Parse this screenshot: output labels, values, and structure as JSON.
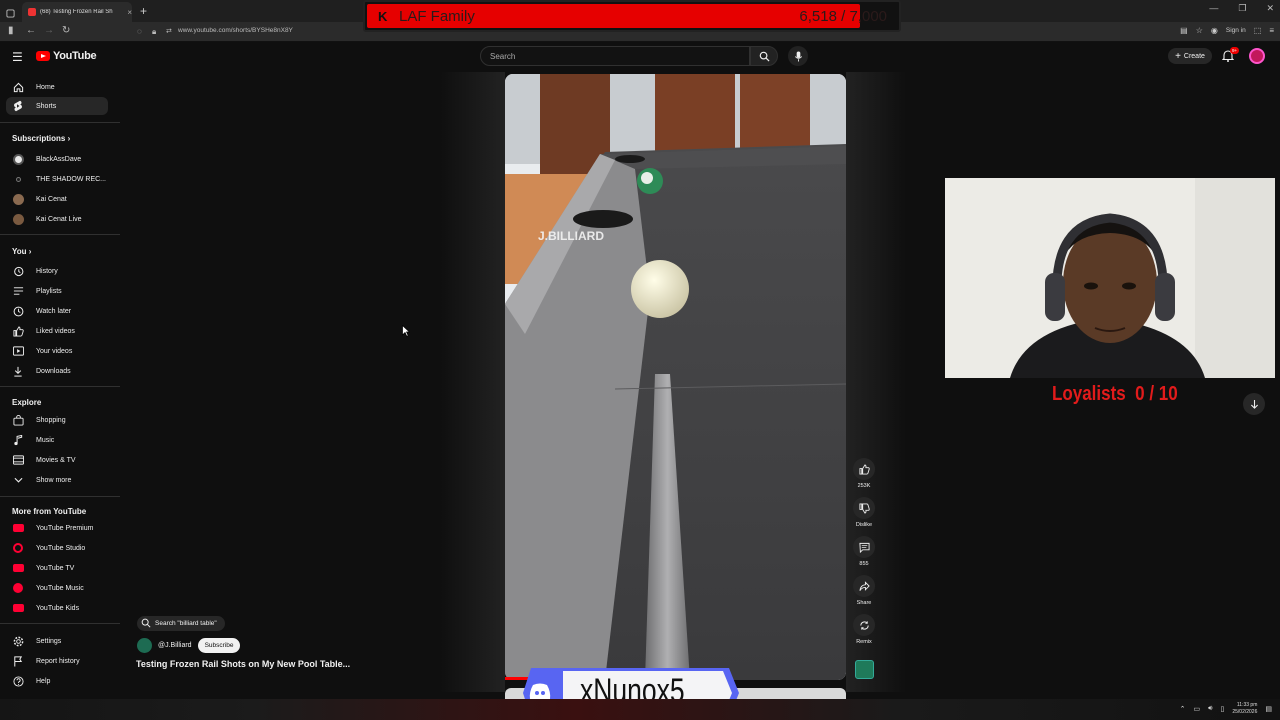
{
  "browser": {
    "tab_title": "(68) Testing Frozen Rail Sh",
    "new_tab": "+",
    "tab_close": "×",
    "url": "www.youtube.com/shorts/BYSHe8nX8Y",
    "sign_in": "Sign in",
    "window_controls": [
      "—",
      "❐",
      "✕"
    ]
  },
  "stream_overlay": {
    "goal_name": "LAF Family",
    "goal_count": "6,518 / 7,000",
    "goal_fraction": 0.93,
    "loyalists_label": "Loyalists",
    "loyalists_count": "0 / 10",
    "discord_name": "xNunox5"
  },
  "header": {
    "logo_text": "YouTube",
    "search_placeholder": "Search",
    "create_label": "Create",
    "notification_badge": "9+"
  },
  "sidebar": {
    "main": [
      {
        "label": "Home",
        "icon": "home-icon"
      },
      {
        "label": "Shorts",
        "icon": "shorts-icon"
      }
    ],
    "subscriptions_title": "Subscriptions",
    "subscriptions": [
      {
        "label": "BlackAssDave",
        "color": "#e8e8e8"
      },
      {
        "label": "THE SHADOW REC...",
        "color": "#1a1a1a"
      },
      {
        "label": "Kai Cenat",
        "color": "#8a6a50"
      },
      {
        "label": "Kai Cenat Live",
        "color": "#7a5a40"
      }
    ],
    "you_title": "You",
    "you": [
      {
        "label": "History",
        "icon": "history-icon"
      },
      {
        "label": "Playlists",
        "icon": "playlists-icon"
      },
      {
        "label": "Watch later",
        "icon": "watch-later-icon"
      },
      {
        "label": "Liked videos",
        "icon": "liked-icon"
      },
      {
        "label": "Your videos",
        "icon": "your-videos-icon"
      },
      {
        "label": "Downloads",
        "icon": "download-icon"
      }
    ],
    "explore_title": "Explore",
    "explore": [
      {
        "label": "Shopping",
        "icon": "shopping-icon"
      },
      {
        "label": "Music",
        "icon": "music-icon"
      },
      {
        "label": "Movies & TV",
        "icon": "movies-icon"
      },
      {
        "label": "Show more",
        "icon": "chevron-down-icon"
      }
    ],
    "more_title": "More from YouTube",
    "more": [
      {
        "label": "YouTube Premium",
        "color": "#ff0033"
      },
      {
        "label": "YouTube Studio",
        "color": "#ff0033"
      },
      {
        "label": "YouTube TV",
        "color": "#ff0033"
      },
      {
        "label": "YouTube Music",
        "color": "#ff0033"
      },
      {
        "label": "YouTube Kids",
        "color": "#ff0033"
      }
    ],
    "bottom": [
      {
        "label": "Settings",
        "icon": "gear-icon"
      },
      {
        "label": "Report history",
        "icon": "flag-icon"
      },
      {
        "label": "Help",
        "icon": "help-icon"
      }
    ]
  },
  "short": {
    "watermark": "J.BILLIARD",
    "search_query": "Search \"billiard table\"",
    "channel": "@J.Billiard",
    "subscribe": "Subscribe",
    "title": "Testing Frozen Rail Shots on My New Pool Table...",
    "actions": {
      "likes": "253K",
      "dislike": "Dislike",
      "comments": "855",
      "share": "Share",
      "remix": "Remix"
    }
  },
  "taskbar": {
    "time": "11:33 pm",
    "date": "25/02/2026"
  },
  "colors": {
    "youtube_red": "#ff0000",
    "overlay_red": "#e21b1b",
    "discord_blurple": "#5865f2"
  }
}
